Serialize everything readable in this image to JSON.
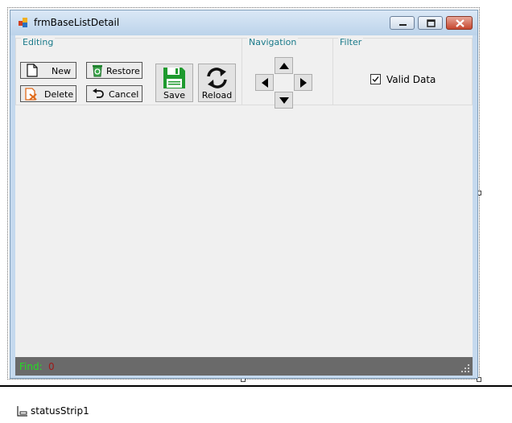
{
  "window": {
    "title": "frmBaseListDetail"
  },
  "editing": {
    "group_label": "Editing",
    "new_label": "New",
    "delete_label": "Delete",
    "restore_label": "Restore",
    "cancel_label": "Cancel",
    "save_label": "Save",
    "reload_label": "Reload"
  },
  "navigation": {
    "group_label": "Navigation",
    "buttons": [
      "up-arrow-icon",
      "left-arrow-icon",
      "right-arrow-icon",
      "down-arrow-icon"
    ]
  },
  "filter": {
    "group_label": "Filter",
    "valid_data_label": "Valid Data",
    "valid_data_checked": true
  },
  "status": {
    "find_label": "Find:",
    "find_count": "0"
  },
  "component_tray": {
    "item_label": "statusStrip1"
  },
  "colors": {
    "group_label": "#1a7a8a",
    "find_label": "#22dd22",
    "find_count": "#a01818",
    "status_bar": "#6a6a6a",
    "save_icon": "#1e9a2e"
  }
}
